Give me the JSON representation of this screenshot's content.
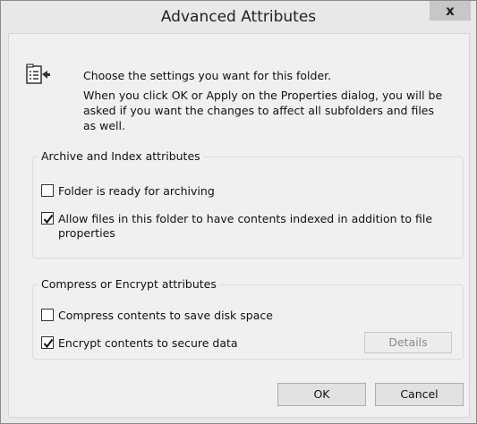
{
  "window": {
    "title": "Advanced Attributes",
    "close_label": "x"
  },
  "intro": {
    "icon": "folder-settings-icon",
    "line1": "Choose the settings you want for this folder.",
    "line2a": "When you click OK or Apply on the Properties dialog, you will be",
    "line2b": "asked if you want the changes to affect all subfolders and files",
    "line2c": "as well."
  },
  "archive_group": {
    "title": "Archive and Index attributes",
    "folder_ready_label": "Folder is ready for archiving",
    "folder_ready_checked": false,
    "allow_index_label_line1": "Allow files in this folder to have contents indexed in addition to file",
    "allow_index_label_line2": "properties",
    "allow_index_checked": true
  },
  "compress_group": {
    "title": "Compress or Encrypt attributes",
    "compress_label": "Compress contents to save disk space",
    "compress_checked": false,
    "encrypt_label": "Encrypt contents to secure data",
    "encrypt_checked": true,
    "details_label": "Details",
    "details_enabled": false
  },
  "buttons": {
    "ok_label": "OK",
    "cancel_label": "Cancel"
  }
}
